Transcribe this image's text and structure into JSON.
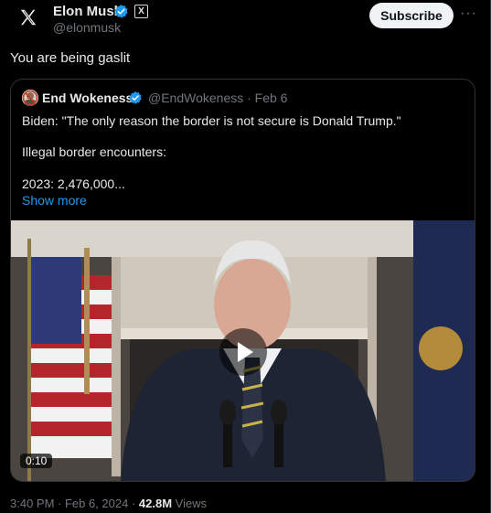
{
  "header": {
    "logo_icon": "x-logo-icon",
    "author_name": "Elon Musk",
    "verified_icon": "verified-badge-icon",
    "affiliation_icon": "x-affiliation-icon",
    "affiliation_label": "X",
    "handle": "@elonmusk",
    "subscribe_label": "Subscribe",
    "more_label": "···"
  },
  "tweet": {
    "text": "You are being gaslit"
  },
  "quote": {
    "author_name": "End Wokeness",
    "handle_date": "@EndWokeness · Feb 6",
    "lines": [
      "Biden: \"The only reason the border is not secure is Donald Trump.\"",
      "Illegal border encounters:",
      "2023: 2,476,000..."
    ],
    "show_more": "Show more",
    "video": {
      "duration": "0:10",
      "play_icon": "play-icon"
    }
  },
  "meta": {
    "time_date": "3:40 PM · Feb 6, 2024 · ",
    "views_count": "42.8M",
    "views_label": " Views"
  },
  "colors": {
    "background": "#000000",
    "text": "#e7e9ea",
    "muted": "#71767b",
    "link": "#1d9bf0",
    "verified": "#1d9bf0",
    "border": "#2f3336"
  }
}
